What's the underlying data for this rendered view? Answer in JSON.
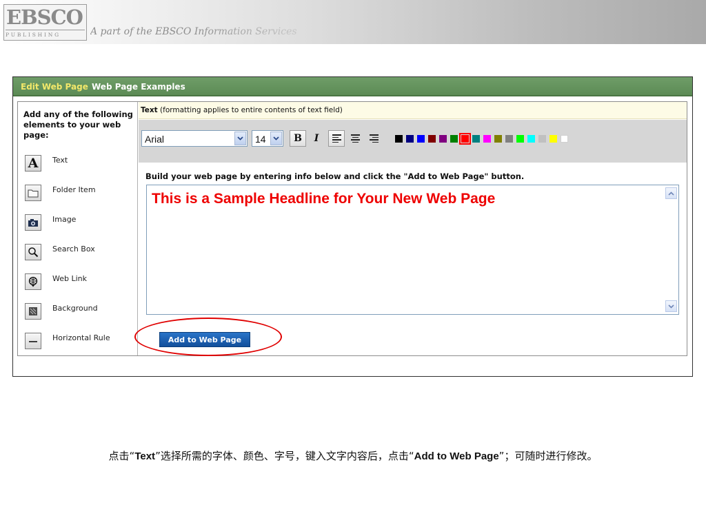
{
  "header": {
    "logo_main": "EBSCO",
    "logo_sub": "PUBLISHING",
    "tagline": "A part of the EBSCO Information Services"
  },
  "tabs": [
    {
      "label": "Edit Web Page",
      "active": true
    },
    {
      "label": "Web Page Examples",
      "active": false
    }
  ],
  "sidebar": {
    "heading": "Add any of the following elements to your web page:",
    "items": [
      {
        "label": "Text",
        "icon": "text-A-icon"
      },
      {
        "label": "Folder Item",
        "icon": "folder-icon"
      },
      {
        "label": "Image",
        "icon": "camera-icon"
      },
      {
        "label": "Search Box",
        "icon": "magnifier-icon"
      },
      {
        "label": "Web Link",
        "icon": "globe-link-icon"
      },
      {
        "label": "Background",
        "icon": "background-icon"
      },
      {
        "label": "Horizontal Rule",
        "icon": "horizontal-rule-icon"
      }
    ]
  },
  "info": {
    "label": "Text",
    "note": " (formatting applies to entire contents of text field)"
  },
  "toolbar": {
    "font": "Arial",
    "size": "14",
    "bold_label": "B",
    "italic_label": "I",
    "palette": [
      "#000000",
      "#000080",
      "#0000ff",
      "#800000",
      "#800080",
      "#008000",
      "#ff0000",
      "#008080",
      "#ff00ff",
      "#808000",
      "#808080",
      "#00ff00",
      "#00ffff",
      "#c0c0c0",
      "#ffff00",
      "#ffffff"
    ],
    "selected_color": "#ff0000"
  },
  "editor": {
    "instruction": "Build your web page by entering info below and click the \"Add to Web Page\" button.",
    "content": "This is a Sample Headline for Your New Web Page"
  },
  "add_button_label": "Add to Web Page",
  "caption": {
    "part1": "点击“",
    "text_word": "Text",
    "part2": "”选择所需的字体、颜色、字号，键入文字内容后，点击“",
    "add_word": "Add to Web Page",
    "part3": "”；可随时进行修改。"
  },
  "colors": {
    "tab_bar": "#5f8e58",
    "active_tab_text": "#f2e86a",
    "headline": "#ee0000",
    "button": "#1a5aa8",
    "highlight": "#e00000"
  }
}
